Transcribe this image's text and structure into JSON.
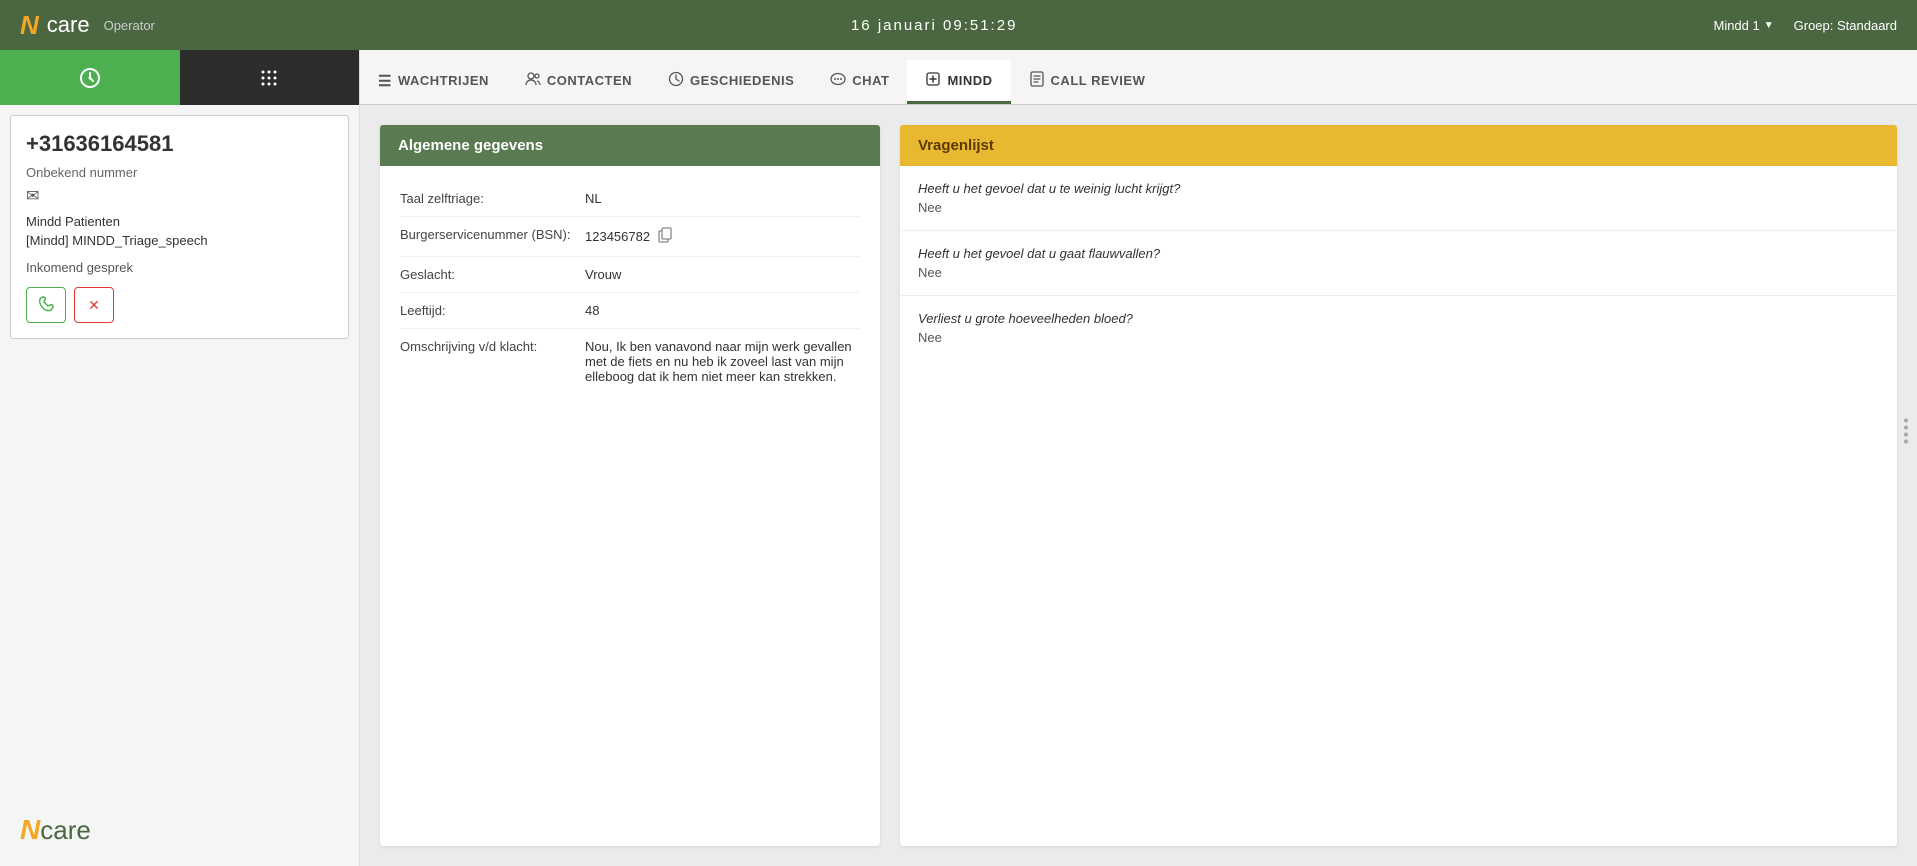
{
  "topbar": {
    "logo_v": "N",
    "logo_care": "care",
    "operator": "Operator",
    "datetime": "16 januari  09:51:29",
    "user": "Mindd 1",
    "group": "Groep: Standaard"
  },
  "sidebar": {
    "phone_number": "+31636164581",
    "caller_status": "Onbekend nummer",
    "patient_label": "Mindd Patienten",
    "triage_label": "[Mindd] MINDD_Triage_speech",
    "incoming_label": "Inkomend gesprek",
    "logo_v": "N",
    "logo_care": "care"
  },
  "nav": {
    "tabs": [
      {
        "id": "wachtrijen",
        "label": "WACHTRIJEN",
        "icon": "☰"
      },
      {
        "id": "contacten",
        "label": "CONTACTEN",
        "icon": "👥"
      },
      {
        "id": "geschiedenis",
        "label": "GESCHIEDENIS",
        "icon": "🕐"
      },
      {
        "id": "chat",
        "label": "CHAT",
        "icon": "💬"
      },
      {
        "id": "mindd",
        "label": "MINDD",
        "icon": "➕"
      },
      {
        "id": "call-review",
        "label": "CALL REVIEW",
        "icon": "📋"
      }
    ],
    "active_tab": "mindd"
  },
  "algemene_gegevens": {
    "header": "Algemene gegevens",
    "fields": [
      {
        "label": "Taal zelftriage:",
        "value": "NL"
      },
      {
        "label": "Burgerservicenummer (BSN):",
        "value": "123456782",
        "has_copy": true
      },
      {
        "label": "Geslacht:",
        "value": "Vrouw"
      },
      {
        "label": "Leeftijd:",
        "value": "48"
      },
      {
        "label": "Omschrijving v/d klacht:",
        "value": "Nou, Ik ben vanavond naar mijn werk gevallen met de fiets en nu heb ik zoveel last van mijn elleboog dat ik hem niet meer kan strekken."
      }
    ]
  },
  "vragenlijst": {
    "header": "Vragenlijst",
    "questions": [
      {
        "question": "Heeft u het gevoel dat u te weinig lucht krijgt?",
        "answer": "Nee"
      },
      {
        "question": "Heeft u het gevoel dat u gaat flauwvallen?",
        "answer": "Nee"
      },
      {
        "question": "Verliest u grote hoeveelheden bloed?",
        "answer": "Nee"
      }
    ]
  }
}
